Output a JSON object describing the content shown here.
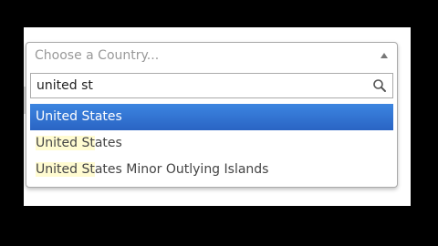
{
  "select": {
    "placeholder": "Choose a Country..."
  },
  "search": {
    "value": "united st",
    "icon": "search-icon"
  },
  "results": [
    {
      "match": "United St",
      "rest": "ates",
      "highlighted": true
    },
    {
      "match": "United St",
      "rest": "ates",
      "highlighted": false
    },
    {
      "match": "United St",
      "rest": "ates Minor Outlying Islands",
      "highlighted": false
    }
  ],
  "colors": {
    "highlight": "#3875d7",
    "match_background": "#fffbd1",
    "backdrop": "#000000"
  }
}
